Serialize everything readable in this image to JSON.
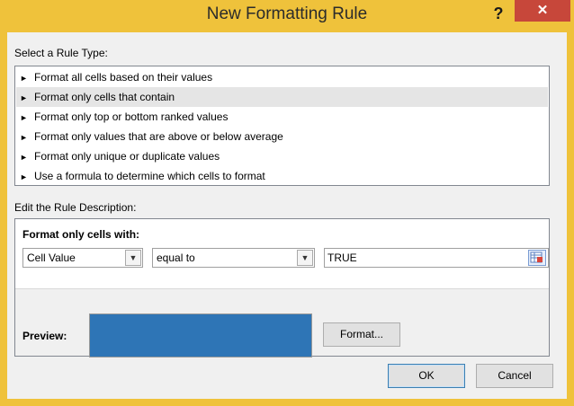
{
  "window": {
    "title": "New Formatting Rule",
    "help_label": "?",
    "close_label": "✕"
  },
  "rule_type": {
    "label": "Select a Rule Type:",
    "items": [
      "Format all cells based on their values",
      "Format only cells that contain",
      "Format only top or bottom ranked values",
      "Format only values that are above or below average",
      "Format only unique or duplicate values",
      "Use a formula to determine which cells to format"
    ],
    "selected_index": 1
  },
  "description": {
    "label": "Edit the Rule Description:",
    "format_only_label": "Format only cells with:",
    "condition_field": "Cell Value",
    "operator": "equal to",
    "value": "TRUE",
    "preview_label": "Preview:",
    "preview_color": "#2e75b6",
    "format_button": "Format..."
  },
  "footer": {
    "ok_label": "OK",
    "cancel_label": "Cancel"
  },
  "colors": {
    "titlebar": "#efc23b",
    "close": "#c7473a",
    "selection": "#e5e5e5"
  }
}
